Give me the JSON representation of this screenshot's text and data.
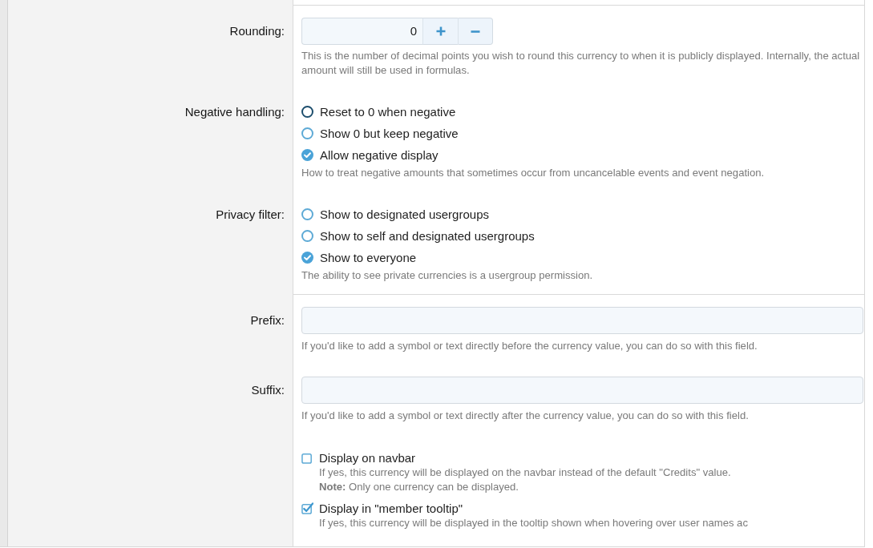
{
  "fields": [
    {
      "kind": "spinner",
      "label": "Rounding:",
      "value": "0",
      "help": "This is the number of decimal points you wish to round this currency to when it is publicly displayed. Internally, the actual amount will still be used in formulas."
    },
    {
      "kind": "radio",
      "label": "Negative handling:",
      "options": [
        {
          "label": "Reset to 0 when negative",
          "selected": false,
          "focused": true
        },
        {
          "label": "Show 0 but keep negative",
          "selected": false,
          "focused": false
        },
        {
          "label": "Allow negative display",
          "selected": true,
          "focused": false
        }
      ],
      "help": "How to treat negative amounts that sometimes occur from uncancelable events and event negation."
    },
    {
      "kind": "radio",
      "label": "Privacy filter:",
      "options": [
        {
          "label": "Show to designated usergroups",
          "selected": false,
          "focused": false
        },
        {
          "label": "Show to self and designated usergroups",
          "selected": false,
          "focused": false
        },
        {
          "label": "Show to everyone",
          "selected": true,
          "focused": false
        }
      ],
      "help": "The ability to see private currencies is a usergroup permission."
    },
    {
      "kind": "divider"
    },
    {
      "kind": "text",
      "label": "Prefix:",
      "help": "If you'd like to add a symbol or text directly before the currency value, you can do so with this field."
    },
    {
      "kind": "text",
      "label": "Suffix:",
      "help": "If you'd like to add a symbol or text directly after the currency value, you can do so with this field."
    },
    {
      "kind": "checkboxes",
      "options": [
        {
          "label": "Display on navbar",
          "checked": false,
          "hint": "If yes, this currency will be displayed on the navbar instead of the default \"Credits\" value.",
          "note": "**Note:** Only one currency can be displayed."
        },
        {
          "label": "Display in \"member tooltip\"",
          "checked": true,
          "hint": "If yes, this currency will be displayed in the tooltip shown when hovering over user names ac"
        }
      ]
    }
  ]
}
